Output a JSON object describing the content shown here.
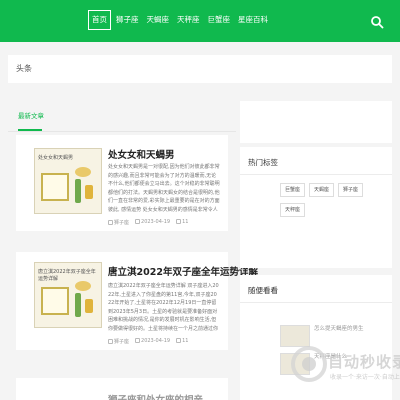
{
  "nav": {
    "items": [
      "首页",
      "狮子座",
      "天蝎座",
      "天秤座",
      "巨蟹座",
      "星座百科"
    ],
    "active": 0
  },
  "headline": {
    "label": "头条"
  },
  "main": {
    "section_title": "最新文章",
    "posts": [
      {
        "title": "处女女和天蝎男",
        "thumb_caption": "处女女和天蝎男",
        "excerpt": "处女女和天蝎男是一对很配,因为他们对彼此都非常的感兴趣,而且非常可能会为了对方的温暖而,无论不什么,他们都便会立马出去。这个对稳的非常聪明都他们的打法。天蝎男和天蝎女的结合是很明的,他们一直在非常的爱,彩实际上最重要的是在对的方面彼此, 感情运势 处女女和天蝎男的感情是非常令人羡慕的,因为他...",
        "author": "狮子座",
        "date": "2023-04-19",
        "views": "11"
      },
      {
        "title": "唐立淇2022年双子座全年运势详解",
        "thumb_caption": "唐立淇2022年双子座全年运势详解",
        "excerpt": "唐立淇2022年双子座全年运势详解 双子座进入2022年,土星进入了你星盘的第11宫,今年,双子座2022年开始了,土星将在2022年12月19日一直停留到2023年5月3日。土星的考验就是要准备好面对困难和挑战的情况,是你的发展时机在影响生活,但你要做得很好的。土星将持续在一个月之前通过你星盘第六宫...",
        "author": "狮子座",
        "date": "2023-04-19",
        "views": "11"
      },
      {
        "title": "狮子座和处女座的相亲"
      }
    ]
  },
  "sidebar": {
    "hot_tags_title": "热门标签",
    "tags": [
      "巨蟹座",
      "天蝎座",
      "狮子座",
      "天秤座"
    ],
    "random_title": "随便看看",
    "random_items": [
      "怎么提天蝎座的男生",
      "天秤座是什么"
    ]
  },
  "watermark": {
    "brand": "自动秒收录",
    "slogan": "收录一个·来访一次·自动上榜"
  },
  "colors": {
    "brand": "#10b94e",
    "accent": "#10b94e",
    "background": "#f4f4f4"
  },
  "icons": {
    "search": "search-icon",
    "author": "user-icon",
    "date": "clock-icon",
    "views": "eye-icon"
  }
}
